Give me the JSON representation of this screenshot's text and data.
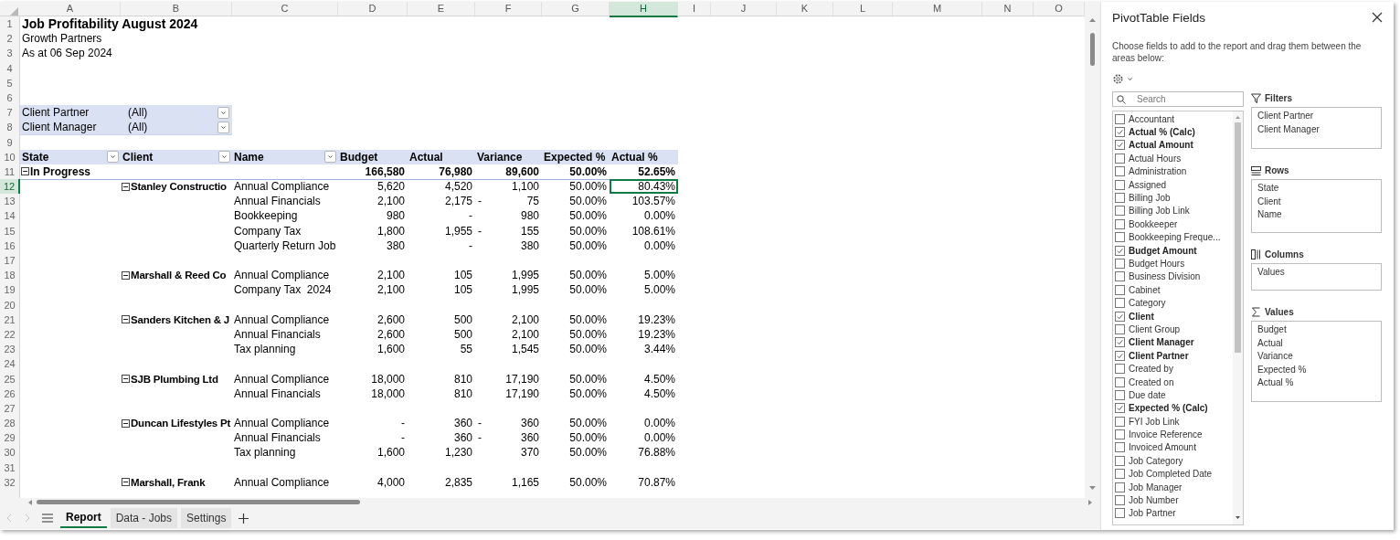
{
  "sheet": {
    "columns": [
      {
        "letter": "A",
        "selected": false
      },
      {
        "letter": "B",
        "selected": false
      },
      {
        "letter": "C",
        "selected": false
      },
      {
        "letter": "D",
        "selected": false
      },
      {
        "letter": "E",
        "selected": false
      },
      {
        "letter": "F",
        "selected": false
      },
      {
        "letter": "G",
        "selected": false
      },
      {
        "letter": "H",
        "selected": true
      },
      {
        "letter": "I",
        "selected": false
      },
      {
        "letter": "J",
        "selected": false
      },
      {
        "letter": "K",
        "selected": false
      },
      {
        "letter": "L",
        "selected": false
      },
      {
        "letter": "M",
        "selected": false
      },
      {
        "letter": "N",
        "selected": false
      },
      {
        "letter": "O",
        "selected": false
      }
    ],
    "rows": [
      {
        "number": "1",
        "kind": "title",
        "text": "Job Profitability August 2024",
        "selected": false
      },
      {
        "number": "2",
        "kind": "text",
        "text": "Growth Partners",
        "selected": false
      },
      {
        "number": "3",
        "kind": "text",
        "text": "As at 06 Sep 2024",
        "selected": false
      },
      {
        "number": "4",
        "kind": "blank",
        "selected": false
      },
      {
        "number": "5",
        "kind": "blank",
        "selected": false
      },
      {
        "number": "6",
        "kind": "blank",
        "selected": false
      },
      {
        "number": "7",
        "kind": "filter",
        "label": "Client Partner",
        "value": "(All)",
        "selected": false
      },
      {
        "number": "8",
        "kind": "filter",
        "label": "Client Manager",
        "value": "(All)",
        "selected": false
      },
      {
        "number": "9",
        "kind": "blank",
        "selected": false
      },
      {
        "number": "10",
        "kind": "header",
        "cells": [
          {
            "text": "State",
            "filter": true
          },
          {
            "text": "Client",
            "filter": true
          },
          {
            "text": "Name",
            "filter": true
          },
          {
            "text": "Budget"
          },
          {
            "text": "Actual"
          },
          {
            "text": "Variance"
          },
          {
            "text": "Expected %"
          },
          {
            "text": "Actual %"
          }
        ],
        "selected": false
      },
      {
        "number": "11",
        "kind": "total",
        "state": "In Progress",
        "expanded": true,
        "budget": "166,580",
        "actual": "76,980",
        "variance": "89,600",
        "expected": "50.00%",
        "actual_pct": "52.65%",
        "selected": false
      },
      {
        "number": "12",
        "kind": "item",
        "client": "Stanley Constructio",
        "expanded": true,
        "name": "Annual Compliance",
        "budget": "5,620",
        "actual": "4,520",
        "variance": "1,100",
        "expected": "50.00%",
        "actual_pct": "80.43%",
        "selected": true
      },
      {
        "number": "13",
        "kind": "item",
        "name": "Annual Financials",
        "budget": "2,100",
        "actual": "2,175",
        "variance_sign": "-",
        "variance": "75",
        "expected": "50.00%",
        "actual_pct": "103.57%",
        "selected": false
      },
      {
        "number": "14",
        "kind": "item",
        "name": "Bookkeeping",
        "budget": "980",
        "actual": "-",
        "variance": "980",
        "expected": "50.00%",
        "actual_pct": "0.00%",
        "selected": false
      },
      {
        "number": "15",
        "kind": "item",
        "name": "Company Tax",
        "budget": "1,800",
        "actual": "1,955",
        "variance_sign": "-",
        "variance": "155",
        "expected": "50.00%",
        "actual_pct": "108.61%",
        "selected": false
      },
      {
        "number": "16",
        "kind": "item",
        "name": "Quarterly Return Job",
        "budget": "380",
        "actual": "-",
        "variance": "380",
        "expected": "50.00%",
        "actual_pct": "0.00%",
        "selected": false
      },
      {
        "number": "17",
        "kind": "blank",
        "selected": false
      },
      {
        "number": "18",
        "kind": "item",
        "client": "Marshall & Reed Co",
        "expanded": true,
        "name": "Annual Compliance",
        "budget": "2,100",
        "actual": "105",
        "variance": "1,995",
        "expected": "50.00%",
        "actual_pct": "5.00%",
        "selected": false
      },
      {
        "number": "19",
        "kind": "item",
        "name": "Company Tax  2024",
        "budget": "2,100",
        "actual": "105",
        "variance": "1,995",
        "expected": "50.00%",
        "actual_pct": "5.00%",
        "selected": false
      },
      {
        "number": "20",
        "kind": "blank",
        "selected": false
      },
      {
        "number": "21",
        "kind": "item",
        "client": "Sanders Kitchen & J",
        "expanded": true,
        "name": "Annual Compliance",
        "budget": "2,600",
        "actual": "500",
        "variance": "2,100",
        "expected": "50.00%",
        "actual_pct": "19.23%",
        "selected": false
      },
      {
        "number": "22",
        "kind": "item",
        "name": "Annual Financials",
        "budget": "2,600",
        "actual": "500",
        "variance": "2,100",
        "expected": "50.00%",
        "actual_pct": "19.23%",
        "selected": false
      },
      {
        "number": "23",
        "kind": "item",
        "name": "Tax planning",
        "budget": "1,600",
        "actual": "55",
        "variance": "1,545",
        "expected": "50.00%",
        "actual_pct": "3.44%",
        "selected": false
      },
      {
        "number": "24",
        "kind": "blank",
        "selected": false
      },
      {
        "number": "25",
        "kind": "item",
        "client": "SJB Plumbing Ltd",
        "expanded": true,
        "name": "Annual Compliance",
        "budget": "18,000",
        "actual": "810",
        "variance": "17,190",
        "expected": "50.00%",
        "actual_pct": "4.50%",
        "selected": false
      },
      {
        "number": "26",
        "kind": "item",
        "name": "Annual Financials",
        "budget": "18,000",
        "actual": "810",
        "variance": "17,190",
        "expected": "50.00%",
        "actual_pct": "4.50%",
        "selected": false
      },
      {
        "number": "27",
        "kind": "blank",
        "selected": false
      },
      {
        "number": "28",
        "kind": "item",
        "client": "Duncan Lifestyles Pt",
        "expanded": true,
        "name": "Annual Compliance",
        "budget": "-",
        "actual": "360",
        "variance_sign": "-",
        "variance": "360",
        "expected": "50.00%",
        "actual_pct": "0.00%",
        "selected": false
      },
      {
        "number": "29",
        "kind": "item",
        "name": "Annual Financials",
        "budget": "-",
        "actual": "360",
        "variance_sign": "-",
        "variance": "360",
        "expected": "50.00%",
        "actual_pct": "0.00%",
        "selected": false
      },
      {
        "number": "30",
        "kind": "item",
        "name": "Tax planning",
        "budget": "1,600",
        "actual": "1,230",
        "variance": "370",
        "expected": "50.00%",
        "actual_pct": "76.88%",
        "selected": false
      },
      {
        "number": "31",
        "kind": "blank",
        "selected": false
      },
      {
        "number": "32",
        "kind": "item",
        "client": "Marshall, Frank",
        "expanded": true,
        "name": "Annual Compliance",
        "budget": "4,000",
        "actual": "2,835",
        "variance": "1,165",
        "expected": "50.00%",
        "actual_pct": "70.87%",
        "selected": false
      }
    ]
  },
  "sheet_tabs": [
    {
      "label": "Report",
      "selected": true
    },
    {
      "label": "Data - Jobs",
      "selected": false
    },
    {
      "label": "Settings",
      "selected": false
    }
  ],
  "pivot_panel": {
    "title": "PivotTable Fields",
    "description": "Choose fields to add to the report and drag them between the areas below:",
    "search": {
      "placeholder": "Search"
    },
    "fields": [
      {
        "label": "Accountant",
        "checked": false
      },
      {
        "label": "Actual % (Calc)",
        "checked": true
      },
      {
        "label": "Actual Amount",
        "checked": true
      },
      {
        "label": "Actual Hours",
        "checked": false
      },
      {
        "label": "Administration",
        "checked": false
      },
      {
        "label": "Assigned",
        "checked": false
      },
      {
        "label": "Billing Job",
        "checked": false
      },
      {
        "label": "Billing Job Link",
        "checked": false
      },
      {
        "label": "Bookkeeper",
        "checked": false
      },
      {
        "label": "Bookkeeping Freque...",
        "checked": false
      },
      {
        "label": "Budget Amount",
        "checked": true
      },
      {
        "label": "Budget Hours",
        "checked": false
      },
      {
        "label": "Business Division",
        "checked": false
      },
      {
        "label": "Cabinet",
        "checked": false
      },
      {
        "label": "Category",
        "checked": false
      },
      {
        "label": "Client",
        "checked": true
      },
      {
        "label": "Client Group",
        "checked": false
      },
      {
        "label": "Client Manager",
        "checked": true
      },
      {
        "label": "Client Partner",
        "checked": true
      },
      {
        "label": "Created by",
        "checked": false
      },
      {
        "label": "Created on",
        "checked": false
      },
      {
        "label": "Due date",
        "checked": false
      },
      {
        "label": "Expected % (Calc)",
        "checked": true
      },
      {
        "label": "FYI Job Link",
        "checked": false
      },
      {
        "label": "Invoice Reference",
        "checked": false
      },
      {
        "label": "Invoiced Amount",
        "checked": false
      },
      {
        "label": "Job Category",
        "checked": false
      },
      {
        "label": "Job Completed Date",
        "checked": false
      },
      {
        "label": "Job Manager",
        "checked": false
      },
      {
        "label": "Job Number",
        "checked": false
      },
      {
        "label": "Job Partner",
        "checked": false
      }
    ],
    "areas": [
      {
        "kind": "filters",
        "label": "Filters",
        "items": [
          "Client Partner",
          "Client Manager"
        ]
      },
      {
        "kind": "rows",
        "label": "Rows",
        "items": [
          "State",
          "Client",
          "Name"
        ]
      },
      {
        "kind": "columns",
        "label": "Columns",
        "items": [
          "Values"
        ]
      },
      {
        "kind": "values",
        "label": "Values",
        "items": [
          "Budget",
          "Actual",
          "Variance",
          "Expected %",
          "Actual %"
        ]
      }
    ]
  }
}
